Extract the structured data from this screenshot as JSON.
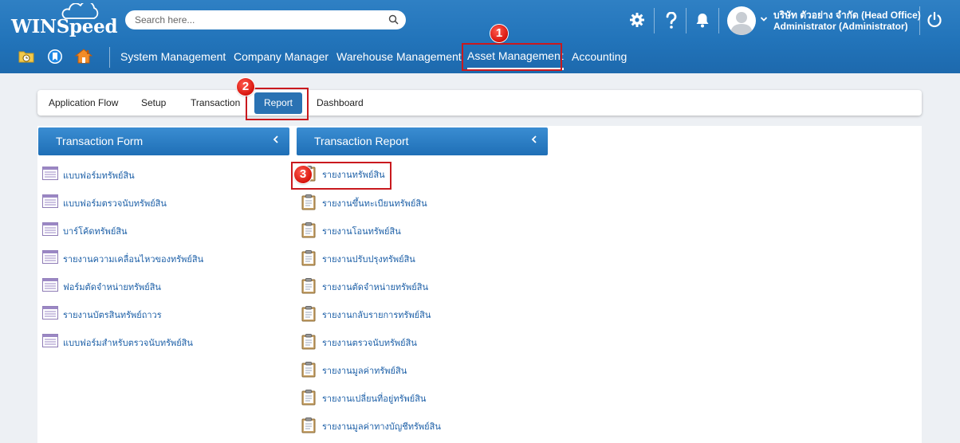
{
  "app": {
    "logo": "WINSpeed"
  },
  "search": {
    "placeholder": "Search here..."
  },
  "user": {
    "company": "บริษัท ตัวอย่าง จำกัด (Head Office)",
    "role": "Administrator (Administrator)"
  },
  "main_nav": [
    {
      "label": "System Management"
    },
    {
      "label": "Company Manager"
    },
    {
      "label": "Warehouse Management"
    },
    {
      "label": "Asset Management"
    },
    {
      "label": "Accounting"
    }
  ],
  "sub_tabs": [
    {
      "label": "Application Flow"
    },
    {
      "label": "Setup"
    },
    {
      "label": "Transaction"
    },
    {
      "label": "Report"
    },
    {
      "label": "Dashboard"
    }
  ],
  "steps": [
    "1",
    "2",
    "3"
  ],
  "transaction_form": {
    "title": "Transaction Form",
    "items": [
      "แบบฟอร์มทรัพย์สิน",
      "แบบฟอร์มตรวจนับทรัพย์สิน",
      "บาร์โค้ดทรัพย์สิน",
      "รายงานความเคลื่อนไหวของทรัพย์สิน",
      "ฟอร์มตัดจำหน่ายทรัพย์สิน",
      "รายงานบัตรสินทรัพย์ถาวร",
      "แบบฟอร์มสำหรับตรวจนับทรัพย์สิน"
    ]
  },
  "transaction_report": {
    "title": "Transaction Report",
    "items": [
      "รายงานทรัพย์สิน",
      "รายงานขึ้นทะเบียนทรัพย์สิน",
      "รายงานโอนทรัพย์สิน",
      "รายงานปรับปรุงทรัพย์สิน",
      "รายงานตัดจำหน่ายทรัพย์สิน",
      "รายงานกลับรายการทรัพย์สิน",
      "รายงานตรวจนับทรัพย์สิน",
      "รายงานมูลค่าทรัพย์สิน",
      "รายงานเปลี่ยนที่อยู่ทรัพย์สิน",
      "รายงานมูลค่าทางบัญชีทรัพย์สิน"
    ]
  },
  "colors": {
    "header": "#2274ba",
    "accent": "#2a72b3",
    "link": "#1c5fa7",
    "annotation": "#c9191e"
  }
}
